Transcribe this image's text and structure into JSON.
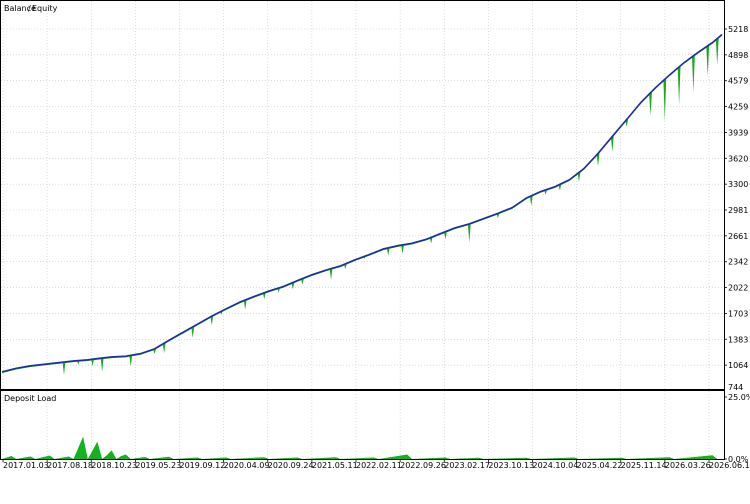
{
  "legend": {
    "balance_label": "Balance",
    "separator": "/",
    "equity_label": "Equity"
  },
  "deposit_panel": {
    "title": "Deposit Load"
  },
  "colors": {
    "balance": "#1c2f9e",
    "equity": "#17a91b",
    "deposit_fill": "#12b31d",
    "grid": "#c8c8c8",
    "frame": "#000000"
  },
  "chart_data": [
    {
      "type": "line",
      "title": "",
      "xlabel": "",
      "ylabel": "",
      "legend": "top-left",
      "grid": true,
      "ylim": [
        744,
        5377
      ],
      "y_ticks": [
        "5218",
        "4898",
        "4579",
        "4259",
        "3939",
        "3620",
        "3300",
        "2981",
        "2661",
        "2342",
        "2022",
        "1703",
        "1383",
        "1064",
        "744"
      ],
      "x_ticks": [
        "2017.01.03",
        "2017.08.18",
        "2018.10.23",
        "2019.05.23",
        "2019.09.12",
        "2020.04.09",
        "2020.09.24",
        "2021.05.11",
        "2022.02.11",
        "2022.09.26",
        "2023.02.17",
        "2023.10.13",
        "2024.10.04",
        "2025.04.22",
        "2025.11.14",
        "2026.03.26",
        "2026.06.11"
      ],
      "series": [
        {
          "name": "Balance",
          "points": [
            [
              0,
              980
            ],
            [
              3,
              1025
            ],
            [
              6,
              1055
            ],
            [
              9,
              1075
            ],
            [
              12,
              1095
            ],
            [
              15,
              1115
            ],
            [
              18,
              1130
            ],
            [
              20,
              1145
            ],
            [
              23,
              1165
            ],
            [
              26,
              1175
            ],
            [
              29,
              1205
            ],
            [
              32,
              1265
            ],
            [
              35,
              1370
            ],
            [
              38,
              1470
            ],
            [
              41,
              1570
            ],
            [
              44,
              1670
            ],
            [
              47,
              1760
            ],
            [
              50,
              1845
            ],
            [
              53,
              1915
            ],
            [
              56,
              1980
            ],
            [
              59,
              2035
            ],
            [
              62,
              2110
            ],
            [
              65,
              2180
            ],
            [
              68,
              2240
            ],
            [
              71,
              2290
            ],
            [
              74,
              2365
            ],
            [
              77,
              2430
            ],
            [
              80,
              2500
            ],
            [
              83,
              2540
            ],
            [
              86,
              2570
            ],
            [
              89,
              2620
            ],
            [
              92,
              2690
            ],
            [
              95,
              2760
            ],
            [
              98,
              2810
            ],
            [
              101,
              2875
            ],
            [
              104,
              2940
            ],
            [
              107,
              3010
            ],
            [
              110,
              3130
            ],
            [
              113,
              3210
            ],
            [
              116,
              3270
            ],
            [
              119,
              3355
            ],
            [
              122,
              3490
            ],
            [
              125,
              3680
            ],
            [
              128,
              3890
            ],
            [
              131,
              4100
            ],
            [
              134,
              4310
            ],
            [
              137,
              4490
            ],
            [
              140,
              4650
            ],
            [
              143,
              4800
            ],
            [
              146,
              4930
            ],
            [
              149,
              5050
            ],
            [
              151,
              5150
            ]
          ]
        },
        {
          "name": "Equity",
          "points": [
            [
              0,
              975
            ],
            [
              3,
              1020
            ],
            [
              6,
              1050
            ],
            [
              9,
              1070
            ],
            [
              12,
              1090
            ],
            [
              15,
              1110
            ],
            [
              18,
              1125
            ],
            [
              20,
              1140
            ],
            [
              23,
              1160
            ],
            [
              26,
              1170
            ],
            [
              29,
              1200
            ],
            [
              32,
              1260
            ],
            [
              35,
              1365
            ],
            [
              38,
              1465
            ],
            [
              41,
              1565
            ],
            [
              44,
              1665
            ],
            [
              47,
              1755
            ],
            [
              50,
              1840
            ],
            [
              53,
              1910
            ],
            [
              56,
              1975
            ],
            [
              59,
              2030
            ],
            [
              62,
              2105
            ],
            [
              65,
              2175
            ],
            [
              68,
              2235
            ],
            [
              71,
              2285
            ],
            [
              74,
              2360
            ],
            [
              77,
              2425
            ],
            [
              80,
              2495
            ],
            [
              83,
              2535
            ],
            [
              86,
              2565
            ],
            [
              89,
              2615
            ],
            [
              92,
              2685
            ],
            [
              95,
              2755
            ],
            [
              98,
              2805
            ],
            [
              101,
              2870
            ],
            [
              104,
              2935
            ],
            [
              107,
              3005
            ],
            [
              110,
              3125
            ],
            [
              113,
              3205
            ],
            [
              116,
              3265
            ],
            [
              119,
              3350
            ],
            [
              122,
              3485
            ],
            [
              125,
              3675
            ],
            [
              128,
              3885
            ],
            [
              131,
              4095
            ],
            [
              134,
              4300
            ],
            [
              137,
              4480
            ],
            [
              140,
              4640
            ],
            [
              143,
              4790
            ],
            [
              146,
              4920
            ],
            [
              149,
              5040
            ],
            [
              151,
              5145
            ]
          ],
          "drawdowns": [
            [
              13,
              940
            ],
            [
              16,
              1070
            ],
            [
              19,
              1050
            ],
            [
              21,
              980
            ],
            [
              27,
              1050
            ],
            [
              32,
              1200
            ],
            [
              34,
              1210
            ],
            [
              40,
              1400
            ],
            [
              44,
              1560
            ],
            [
              46,
              1690
            ],
            [
              51,
              1750
            ],
            [
              55,
              1880
            ],
            [
              58,
              1960
            ],
            [
              61,
              2000
            ],
            [
              63,
              2060
            ],
            [
              69,
              2120
            ],
            [
              72,
              2250
            ],
            [
              76,
              2380
            ],
            [
              81,
              2420
            ],
            [
              84,
              2440
            ],
            [
              90,
              2570
            ],
            [
              93,
              2620
            ],
            [
              98,
              2580
            ],
            [
              104,
              2880
            ],
            [
              111,
              3030
            ],
            [
              114,
              3170
            ],
            [
              117,
              3220
            ],
            [
              121,
              3330
            ],
            [
              125,
              3520
            ],
            [
              128,
              3700
            ],
            [
              131,
              4010
            ],
            [
              136,
              4150
            ],
            [
              139,
              4080
            ],
            [
              142,
              4280
            ],
            [
              145,
              4440
            ],
            [
              148,
              4640
            ],
            [
              150,
              4770
            ]
          ]
        }
      ]
    },
    {
      "type": "area",
      "title": "Deposit Load",
      "xlabel": "",
      "ylabel": "",
      "grid": true,
      "ylim": [
        0,
        25
      ],
      "y_ticks": [
        "25.0%",
        "0.0%"
      ],
      "series": [
        {
          "name": "Deposit Load",
          "points": [
            [
              0,
              0
            ],
            [
              2,
              1.2
            ],
            [
              3,
              0
            ],
            [
              6,
              1.0
            ],
            [
              7,
              0
            ],
            [
              10,
              1.4
            ],
            [
              11,
              0
            ],
            [
              14,
              1.0
            ],
            [
              15,
              0
            ],
            [
              16,
              4.5
            ],
            [
              17,
              9.0
            ],
            [
              18,
              0
            ],
            [
              19,
              3.5
            ],
            [
              20,
              7.0
            ],
            [
              21,
              0
            ],
            [
              22,
              1.5
            ],
            [
              23,
              3.5
            ],
            [
              24,
              0
            ],
            [
              25,
              1.2
            ],
            [
              26,
              1.8
            ],
            [
              27,
              0
            ],
            [
              30,
              0.8
            ],
            [
              31,
              0
            ],
            [
              35,
              0.9
            ],
            [
              36,
              0
            ],
            [
              41,
              0.6
            ],
            [
              42,
              0
            ],
            [
              47,
              0.6
            ],
            [
              48,
              0
            ],
            [
              55,
              0.7
            ],
            [
              56,
              0
            ],
            [
              62,
              0.6
            ],
            [
              63,
              0
            ],
            [
              70,
              0.7
            ],
            [
              71,
              0
            ],
            [
              78,
              0.6
            ],
            [
              79,
              0
            ],
            [
              85,
              1.8
            ],
            [
              86,
              0
            ],
            [
              93,
              0.6
            ],
            [
              94,
              0
            ],
            [
              100,
              0.5
            ],
            [
              101,
              0
            ],
            [
              110,
              0.5
            ],
            [
              111,
              0
            ],
            [
              120,
              0.6
            ],
            [
              121,
              0
            ],
            [
              130,
              0.5
            ],
            [
              131,
              0
            ],
            [
              140,
              0.7
            ],
            [
              141,
              0
            ],
            [
              149,
              1.5
            ],
            [
              150,
              0
            ],
            [
              151,
              0
            ]
          ]
        }
      ]
    }
  ]
}
